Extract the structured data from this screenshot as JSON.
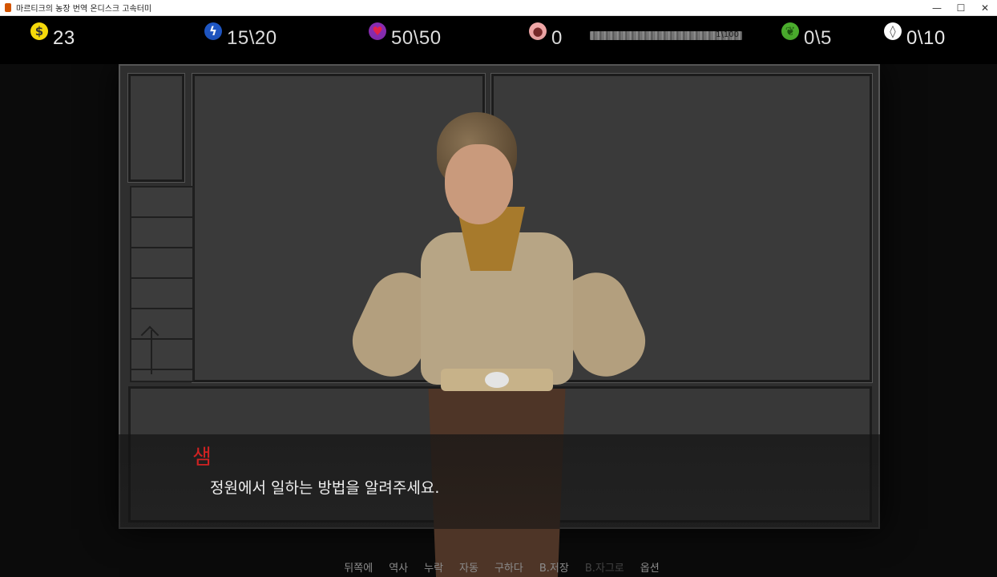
{
  "window": {
    "title": "마르티크의 농장 번역 온디스크 고속터미",
    "controls": {
      "minimize": "—",
      "maximize": "☐",
      "close": "✕"
    }
  },
  "hud": {
    "money": {
      "icon": "dollar-icon",
      "value": "23",
      "color": "#f5d90a"
    },
    "energy": {
      "icon": "lightning-icon",
      "value": "15\\20",
      "color": "#1f57c5"
    },
    "health": {
      "icon": "heart-icon",
      "value": "50\\50",
      "color": "#8a2db3"
    },
    "lust": {
      "icon": "fertility-icon",
      "value": "0",
      "color": "#f1a8a8"
    },
    "xp_bar": {
      "text": "1\\100",
      "progress": 0.01
    },
    "seeds": {
      "icon": "sprout-icon",
      "value": "0\\5",
      "color": "#4caf2e"
    },
    "water": {
      "icon": "water-drop-icon",
      "value": "0\\10",
      "color": "#ffffff"
    }
  },
  "dialogue": {
    "speaker": "샘",
    "text": "정원에서 일하는 방법을 알려주세요."
  },
  "quick_menu": [
    {
      "label": "뒤쪽에",
      "enabled": true
    },
    {
      "label": "역사",
      "enabled": true
    },
    {
      "label": "누락",
      "enabled": true
    },
    {
      "label": "자동",
      "enabled": true
    },
    {
      "label": "구하다",
      "enabled": true
    },
    {
      "label": "B.저장",
      "enabled": true
    },
    {
      "label": "B.자그로",
      "enabled": false
    },
    {
      "label": "옵션",
      "enabled": true
    }
  ]
}
